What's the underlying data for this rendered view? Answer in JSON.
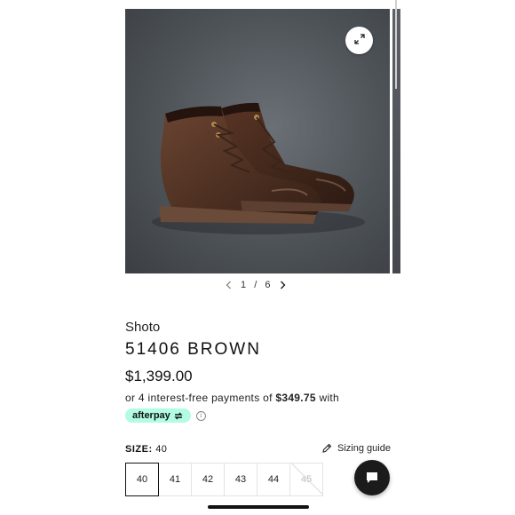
{
  "gallery": {
    "image_alt": "Shoto 51406 BROWN boots",
    "current": "1",
    "separator": "/",
    "total": "6"
  },
  "product": {
    "brand": "Shoto",
    "model": "51406 BROWN",
    "price": "$1,399.00",
    "installments_prefix": "or 4 interest-free payments of ",
    "installment_amount": "$349.75",
    "installments_suffix": " with",
    "afterpay_label": "afterpay"
  },
  "size": {
    "label": "SIZE:",
    "selected": "40",
    "guide_label": "Sizing guide",
    "options": [
      "40",
      "41",
      "42",
      "43",
      "44",
      "45"
    ]
  },
  "colors": {
    "afterpay_mint": "#b2fce4",
    "chat_button": "#1b1b1b"
  },
  "icons": {
    "expand": "expand-icon",
    "prev": "chevron-left-icon",
    "next": "chevron-right-icon",
    "info": "info-icon",
    "ruler": "pencil-ruler-icon",
    "chat": "chat-icon"
  }
}
